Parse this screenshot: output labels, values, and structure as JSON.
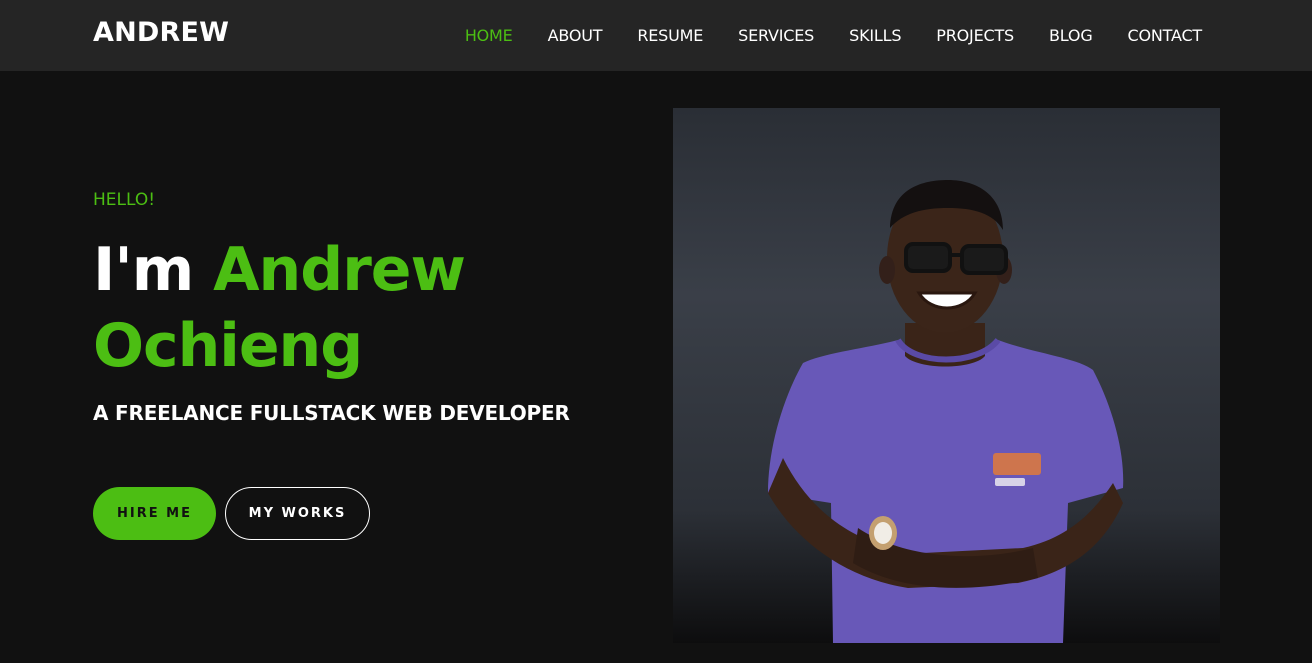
{
  "header": {
    "brand": "ANDREW",
    "nav": [
      {
        "label": "HOME",
        "active": true
      },
      {
        "label": "ABOUT"
      },
      {
        "label": "RESUME"
      },
      {
        "label": "SERVICES"
      },
      {
        "label": "SKILLS"
      },
      {
        "label": "PROJECTS"
      },
      {
        "label": "BLOG"
      },
      {
        "label": "CONTACT"
      }
    ]
  },
  "hero": {
    "greeting": "HELLO!",
    "intro": "I'm",
    "name_first": "Andrew",
    "name_last": "Ochieng",
    "subtitle": "A FREELANCE FULLSTACK WEB DEVELOPER",
    "buttons": {
      "primary": "HIRE ME",
      "secondary": "MY WORKS"
    }
  },
  "colors": {
    "accent": "#4cbe13",
    "background": "#111111",
    "navbar": "#252525"
  }
}
